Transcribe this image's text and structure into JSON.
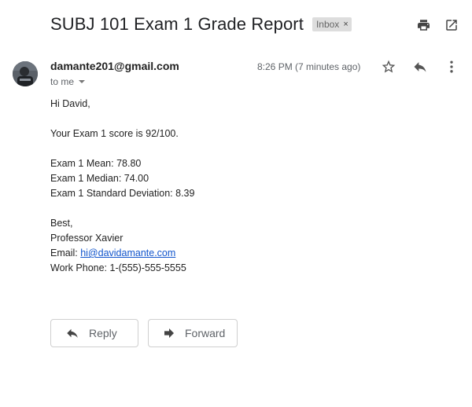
{
  "email": {
    "subject": "SUBJ 101 Exam 1 Grade Report",
    "label": "Inbox",
    "label_remove": "×",
    "sender": "damante201@gmail.com",
    "recipient": "to me",
    "timestamp": "8:26 PM (7 minutes ago)",
    "body": {
      "greeting": "Hi David,",
      "score_line": "Your Exam 1 score is 92/100.",
      "mean_line": "Exam 1 Mean: 78.80",
      "median_line": "Exam 1 Median: 74.00",
      "stddev_line": "Exam 1 Standard Deviation: 8.39",
      "closing": "Best,",
      "signature_name": "Professor Xavier",
      "email_prefix": "Email: ",
      "email_link": "hi@davidamante.com",
      "phone_line": "Work Phone: 1-(555)-555-5555"
    }
  },
  "actions": {
    "reply_label": "Reply",
    "forward_label": "Forward"
  },
  "icons": {
    "print": "printer-icon",
    "open_new_window": "open-in-new-icon",
    "star": "star-icon",
    "reply": "reply-icon",
    "more": "more-vert-icon",
    "forward": "forward-icon",
    "caret": "caret-down-icon"
  },
  "colors": {
    "link": "#1155cc",
    "label_bg": "#dddddd",
    "icon": "#5f6368"
  }
}
